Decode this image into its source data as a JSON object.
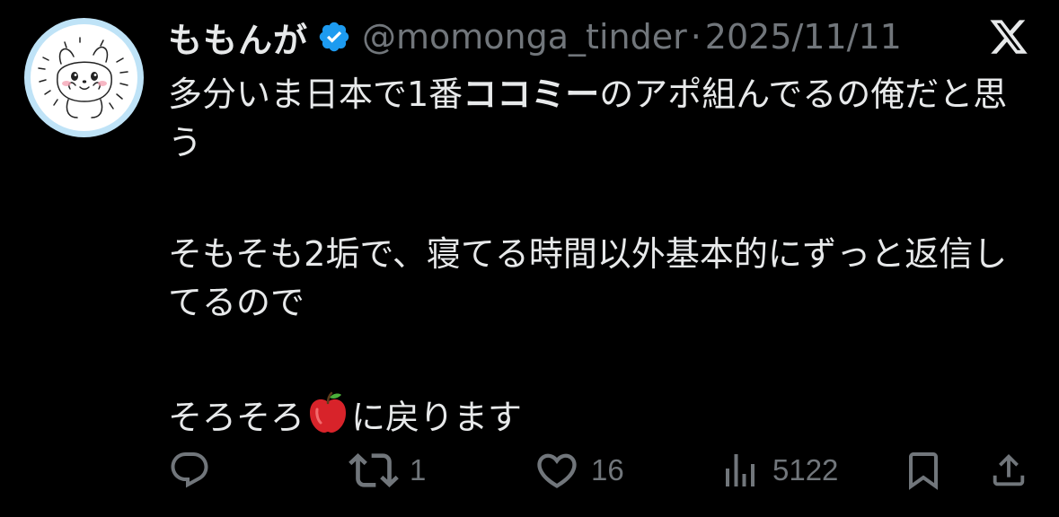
{
  "tweet": {
    "author": {
      "display_name": "ももんが",
      "handle": "@momonga_tinder",
      "verified": true,
      "avatar_icon": "momonga-character-avatar"
    },
    "separator": "·",
    "date": "2025/11/11",
    "platform_icon": "x-logo-icon",
    "body": {
      "line1_pre": "多分いま日本で1番",
      "line1_bold": "ココミー",
      "line1_post": "のアポ組んでるの俺だと思う",
      "line2": "そもそも2垢で、寝てる時間以外基本的にずっと返信してるので",
      "line3_pre": "そろそろ",
      "line3_emoji": "red-apple-emoji",
      "line3_post": "に戻ります"
    },
    "actions": {
      "reply_count": "",
      "retweet_count": "1",
      "like_count": "16",
      "view_count": "5122"
    },
    "colors": {
      "background": "#000000",
      "text": "#e7e9ea",
      "secondary": "#71767b",
      "verified_blue": "#1d9bf0",
      "avatar_ring": "#bfe3f7"
    }
  }
}
